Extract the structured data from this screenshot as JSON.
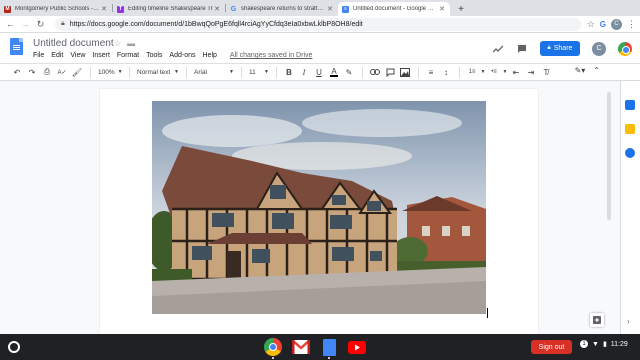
{
  "tabs": [
    {
      "title": "Montgomery Public Schools - Bl",
      "color": "#b3261e",
      "glyph": "M"
    },
    {
      "title": "Editing timeline Shakespeare Tr",
      "color": "#9334e6",
      "glyph": "T"
    },
    {
      "title": "shakespeare returns to stratford",
      "color": "#ffffff",
      "glyph": "G"
    },
    {
      "title": "Untitled document - Google Docs",
      "color": "#4285f4",
      "glyph": "≡"
    }
  ],
  "address": {
    "url": "https://docs.google.com/document/d/1bBwqQoPgE6fqll4rciAgYyCfdq3eIa0xbwLklbP8OH8/edit"
  },
  "browser_profile_initial": "C",
  "docs": {
    "title": "Untitled document",
    "menu": [
      "File",
      "Edit",
      "View",
      "Insert",
      "Format",
      "Tools",
      "Add-ons",
      "Help"
    ],
    "saved_status": "All changes saved in Drive",
    "share_label": "Share",
    "avatar_initial": "C"
  },
  "toolbar": {
    "zoom": "100%",
    "style": "Normal text",
    "font": "Arial",
    "size": "11",
    "bold": "B",
    "italic": "I",
    "underline": "U",
    "text_color": "A"
  },
  "shelf": {
    "signout_label": "Sign out",
    "time": "11:29",
    "notification_count": "1"
  }
}
